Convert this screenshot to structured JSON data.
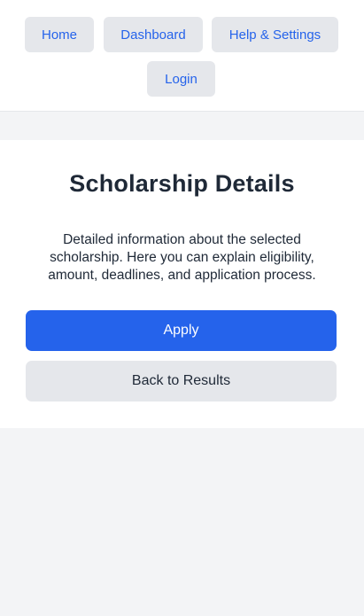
{
  "nav": {
    "home": "Home",
    "dashboard": "Dashboard",
    "help": "Help & Settings",
    "login": "Login"
  },
  "details": {
    "title": "Scholarship Details",
    "description": "Detailed information about the selected scholarship. Here you can explain eligibility, amount, deadlines, and application process."
  },
  "actions": {
    "apply_label": "Apply",
    "back_label": "Back to Results"
  },
  "colors": {
    "primary": "#2563eb",
    "secondary_button": "#e5e7eb",
    "page_background": "#f3f4f6"
  }
}
